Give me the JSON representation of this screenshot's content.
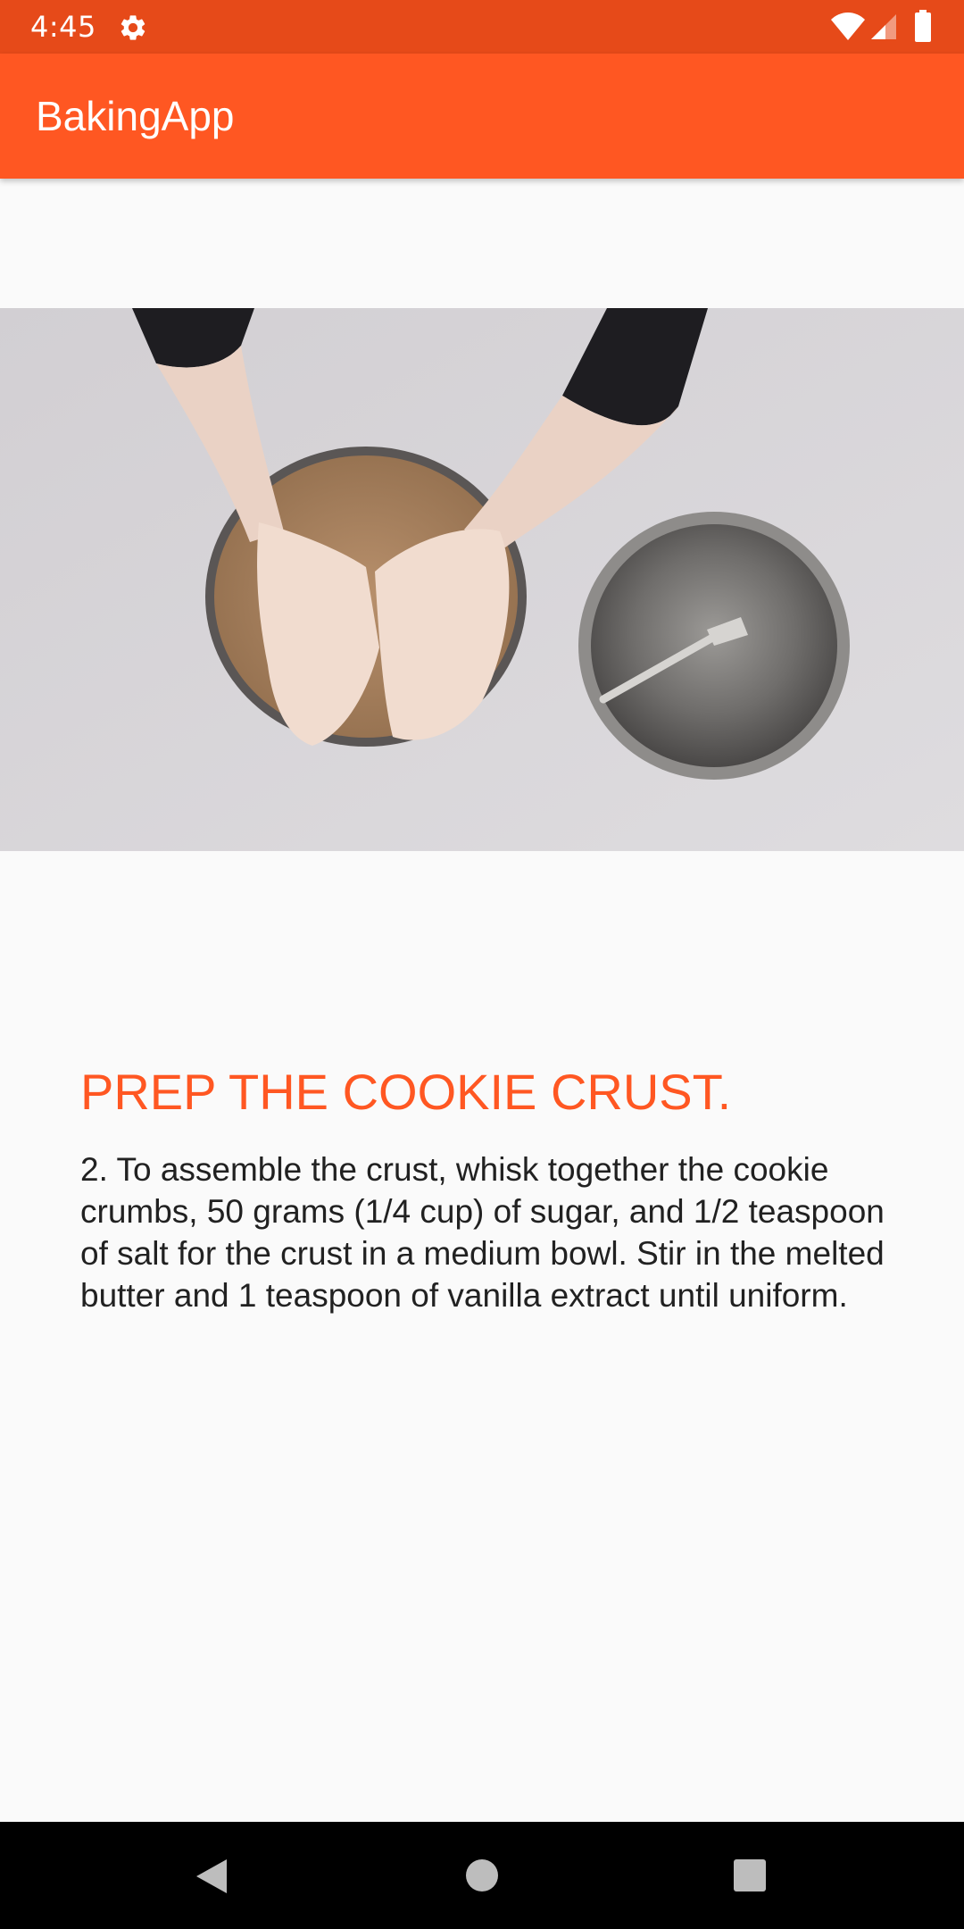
{
  "status_bar": {
    "time": "4:45",
    "settings_icon": "gear-icon",
    "wifi_icon": "wifi-icon",
    "signal_icon": "cell-signal-icon",
    "battery_icon": "battery-icon"
  },
  "app_bar": {
    "title": "BakingApp"
  },
  "video": {
    "description": "Step video frame"
  },
  "step": {
    "short_description": "PREP THE COOKIE CRUST.",
    "description": "2. To assemble the crust, whisk together the cookie crumbs, 50 grams (1/4 cup) of sugar, and 1/2 teaspoon of salt for the crust in a medium bowl. Stir in the melted butter and 1 teaspoon of vanilla extract until uniform."
  },
  "nav_bar": {
    "back_icon": "back-icon",
    "home_icon": "home-icon",
    "recents_icon": "recents-icon"
  },
  "colors": {
    "status_bar": "#E64A19",
    "primary": "#FF5722",
    "accent_text": "#FF5722",
    "body_text": "#212121",
    "background": "#FAFAFA"
  }
}
